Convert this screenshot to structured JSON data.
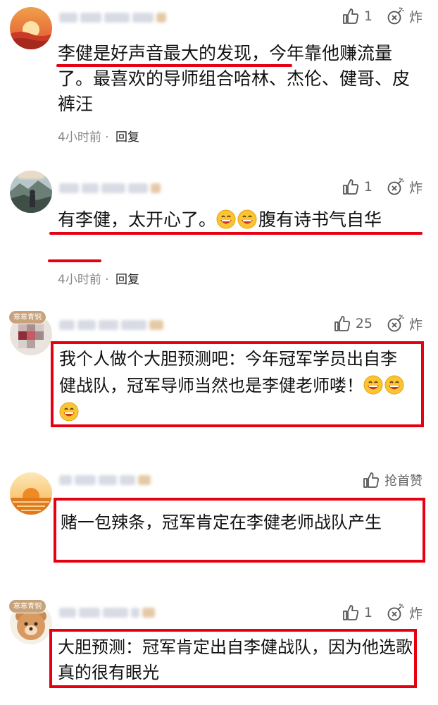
{
  "comments": [
    {
      "text": "李健是好声音最大的发现，今年靠他赚流量了。最喜欢的导师组合哈林、杰伦、健哥、皮裤汪",
      "time": "4小时前",
      "separator": "·",
      "reply": "回复",
      "likes": "1",
      "bomb": "炸"
    },
    {
      "text_before": "有李健，太开心了。",
      "text_after": "腹有诗书气自华",
      "time": "4小时前",
      "separator": "·",
      "reply": "回复",
      "likes": "1",
      "bomb": "炸"
    },
    {
      "text": "我个人做个大胆预测吧：今年冠军学员出自李健战队，冠军导师当然也是李健老师喽！",
      "likes": "25",
      "bomb": "炸",
      "badge": "寒寒青铜"
    },
    {
      "text": "赌一包辣条，冠军肯定在李健老师战队产生",
      "first_like": "抢首赞"
    },
    {
      "text": "大胆预测：冠军肯定出自李健战队，因为他选歌真的很有眼光",
      "likes": "1",
      "bomb": "炸",
      "badge": "寒寒青铜"
    }
  ],
  "colors": {
    "highlight": "#e60012",
    "meta": "#888888",
    "action": "#666666"
  }
}
